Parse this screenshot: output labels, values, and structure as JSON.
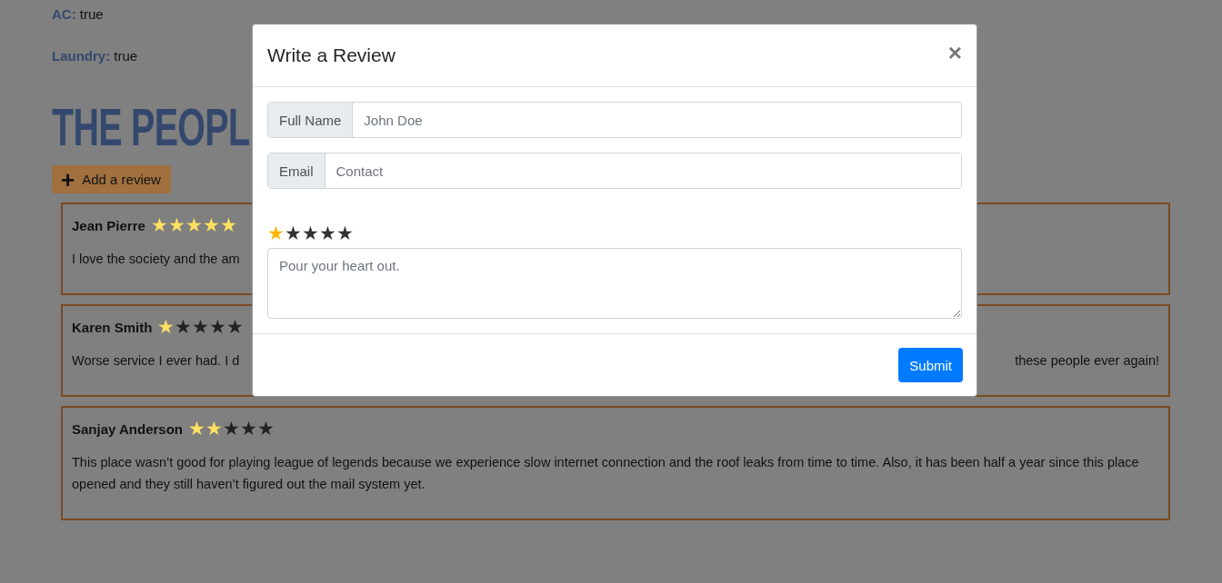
{
  "amenities": [
    {
      "label": "AC:",
      "value": "true"
    },
    {
      "label": "Laundry:",
      "value": "true"
    }
  ],
  "heading": "THE PEOPL",
  "add_button": {
    "icon": "+",
    "label": "Add a review"
  },
  "reviews": [
    {
      "name": "Jean Pierre",
      "stars": 5,
      "text_parts": [
        "I love the society and the am"
      ]
    },
    {
      "name": "Karen Smith",
      "stars": 1,
      "text_parts": [
        "Worse service I ever had. I d",
        "these people ever again!"
      ]
    },
    {
      "name": "Sanjay Anderson",
      "stars": 2,
      "text_parts": [
        "This place wasn’t good for playing league of legends because we experience slow internet connection and the roof leaks from time to time. Also, it has been half a year since this place opened and they still haven’t figured out the mail system yet."
      ]
    }
  ],
  "modal": {
    "title": "Write a Review",
    "close": "×",
    "fields": [
      {
        "label": "Full Name",
        "placeholder": "John Doe"
      },
      {
        "label": "Email",
        "placeholder": "Contact"
      }
    ],
    "rating": {
      "stars": 1
    },
    "comment": {
      "placeholder": "Pour your heart out."
    },
    "submit": "Submit"
  }
}
